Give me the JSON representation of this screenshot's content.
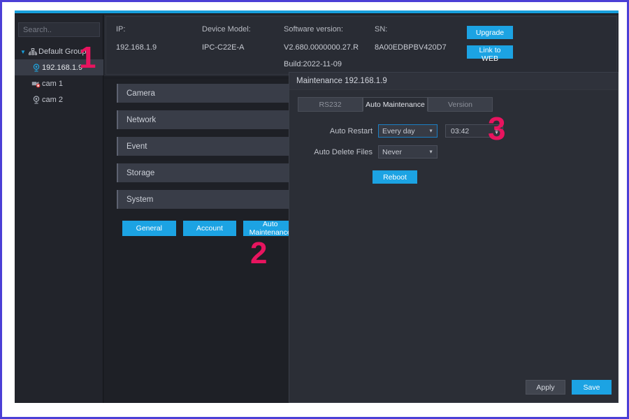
{
  "window": {
    "accent_color": "#18a0dc",
    "frame_color": "#4b3fd6"
  },
  "sidebar": {
    "search": {
      "placeholder": "Search..",
      "value": "",
      "icon": "search-icon"
    },
    "tree": {
      "group": {
        "label": "Default Group",
        "caret": "▼",
        "icon": "network-group-icon",
        "expanded": true
      },
      "items": [
        {
          "label": "192.168.1.9",
          "icon": "camera-online-icon",
          "selected": true
        },
        {
          "label": "cam 1",
          "icon": "camera-error-icon",
          "selected": false
        },
        {
          "label": "cam 2",
          "icon": "camera-offline-icon",
          "selected": false
        }
      ]
    }
  },
  "info_panel": {
    "columns": [
      {
        "label": "IP:",
        "value": "192.168.1.9"
      },
      {
        "label": "Device Model:",
        "value": "IPC-C22E-A"
      },
      {
        "label": "Software version:",
        "value": "V2.680.0000000.27.R",
        "build": "Build:2022-11-09"
      },
      {
        "label": "SN:",
        "value": "8A00EDBPBV420D7"
      }
    ],
    "buttons": {
      "upgrade": "Upgrade",
      "link_to_web": "Link to WEB"
    }
  },
  "menu": {
    "accordions": [
      {
        "label": "Camera"
      },
      {
        "label": "Network"
      },
      {
        "label": "Event"
      },
      {
        "label": "Storage"
      },
      {
        "label": "System"
      }
    ],
    "system_buttons": [
      {
        "label": "General"
      },
      {
        "label": "Account"
      },
      {
        "label": "Auto Maintenance"
      }
    ]
  },
  "dialog": {
    "title": "Maintenance 192.168.1.9",
    "tabs": [
      {
        "label": "RS232",
        "active": false
      },
      {
        "label": "Auto Maintenance",
        "active": true
      },
      {
        "label": "Version",
        "active": false
      }
    ],
    "form": {
      "auto_restart": {
        "label": "Auto Restart",
        "value": "Every day",
        "arrow": "▼",
        "time": "03:42",
        "spin_up": "▲",
        "spin_down": "▼"
      },
      "auto_delete_files": {
        "label": "Auto Delete Files",
        "value": "Never",
        "arrow": "▼"
      },
      "reboot_button": "Reboot"
    },
    "footer": {
      "apply": "Apply",
      "save": "Save"
    }
  },
  "annotations": [
    {
      "number": "1"
    },
    {
      "number": "2"
    },
    {
      "number": "3"
    }
  ]
}
